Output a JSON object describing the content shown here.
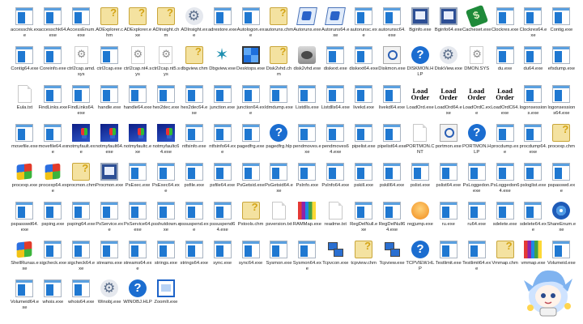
{
  "items": [
    {
      "label": "accesschk.exe",
      "icon": "exe"
    },
    {
      "label": "accesschk64.exe",
      "icon": "exe"
    },
    {
      "label": "AccessEnum.exe",
      "icon": "exe"
    },
    {
      "label": "ADExplorer.chm",
      "icon": "chm"
    },
    {
      "label": "ADExplorer.exe",
      "icon": "chm"
    },
    {
      "label": "ADInsight.chm",
      "icon": "chm"
    },
    {
      "label": "ADInsight.exe",
      "icon": "gear"
    },
    {
      "label": "adrestore.exe",
      "icon": "exe"
    },
    {
      "label": "Autologon.exe",
      "icon": "exe"
    },
    {
      "label": "autoruns.chm",
      "icon": "chm"
    },
    {
      "label": "Autoruns.exe",
      "icon": "autorun"
    },
    {
      "label": "Autoruns64.exe",
      "icon": "autorun"
    },
    {
      "label": "autorunsc.exe",
      "icon": "exe"
    },
    {
      "label": "autorunsc64.exe",
      "icon": "exe"
    },
    {
      "label": "Bginfo.exe",
      "icon": "mon"
    },
    {
      "label": "Bginfo64.exe",
      "icon": "mon"
    },
    {
      "label": "Cacheset.exe",
      "icon": "green"
    },
    {
      "label": "Clockres.exe",
      "icon": "exe"
    },
    {
      "label": "Clockres64.exe",
      "icon": "exe"
    },
    {
      "label": "Contig.exe",
      "icon": "exe"
    },
    {
      "label": "Contig64.exe",
      "icon": "exe"
    },
    {
      "label": "Coreinfo.exe",
      "icon": "exe"
    },
    {
      "label": "ctrl2cap.amd.sys",
      "icon": "sys"
    },
    {
      "label": "ctrl2cap.exe",
      "icon": "exe"
    },
    {
      "label": "ctrl2cap.nt4.sys",
      "icon": "sys"
    },
    {
      "label": "ctrl2cap.nt5.sys",
      "icon": "sys"
    },
    {
      "label": "dbgview.chm",
      "icon": "chm"
    },
    {
      "label": "Dbgview.exe",
      "icon": "bug"
    },
    {
      "label": "Desktops.exe",
      "icon": "grid4"
    },
    {
      "label": "Disk2vhd.chm",
      "icon": "chm"
    },
    {
      "label": "disk2vhd.exe",
      "icon": "disk"
    },
    {
      "label": "diskext.exe",
      "icon": "exe"
    },
    {
      "label": "diskext64.exe",
      "icon": "exe"
    },
    {
      "label": "Diskmon.exe",
      "icon": "mag"
    },
    {
      "label": "DISKMON.HLP",
      "icon": "hlp"
    },
    {
      "label": "DiskView.exe",
      "icon": "gear"
    },
    {
      "label": "DMON.SYS",
      "icon": "sys"
    },
    {
      "label": "du.exe",
      "icon": "exe"
    },
    {
      "label": "du64.exe",
      "icon": "exe"
    },
    {
      "label": "efsdump.exe",
      "icon": "exe"
    },
    {
      "label": "Eula.txt",
      "icon": "doc"
    },
    {
      "label": "FindLinks.exe",
      "icon": "exe"
    },
    {
      "label": "FindLinks64.exe",
      "icon": "exe"
    },
    {
      "label": "handle.exe",
      "icon": "exe"
    },
    {
      "label": "handle64.exe",
      "icon": "exe"
    },
    {
      "label": "hex2dec.exe",
      "icon": "exe"
    },
    {
      "label": "hex2dec64.exe",
      "icon": "exe"
    },
    {
      "label": "junction.exe",
      "icon": "exe"
    },
    {
      "label": "junction64.exe",
      "icon": "exe"
    },
    {
      "label": "ldmdump.exe",
      "icon": "exe"
    },
    {
      "label": "Listdlls.exe",
      "icon": "exe"
    },
    {
      "label": "Listdlls64.exe",
      "icon": "exe"
    },
    {
      "label": "livekd.exe",
      "icon": "exe"
    },
    {
      "label": "livekd64.exe",
      "icon": "exe"
    },
    {
      "label": "LoadOrd.exe",
      "icon": "load"
    },
    {
      "label": "LoadOrd64.exe",
      "icon": "load"
    },
    {
      "label": "LoadOrdC.exe",
      "icon": "load"
    },
    {
      "label": "LoadOrdC64.exe",
      "icon": "load"
    },
    {
      "label": "logonsessions.exe",
      "icon": "exe"
    },
    {
      "label": "logonsessions64.exe",
      "icon": "exe"
    },
    {
      "label": "movefile.exe",
      "icon": "exe"
    },
    {
      "label": "movefile64.exe",
      "icon": "exe"
    },
    {
      "label": "notmyfault.exe",
      "icon": "nt"
    },
    {
      "label": "notmyfault64.exe",
      "icon": "nt"
    },
    {
      "label": "notmyfaultc.exe",
      "icon": "nt"
    },
    {
      "label": "notmyfaultc64.exe",
      "icon": "nt"
    },
    {
      "label": "ntfsinfo.exe",
      "icon": "exe"
    },
    {
      "label": "ntfsinfo64.exe",
      "icon": "exe"
    },
    {
      "label": "pagedfrg.exe",
      "icon": "exe"
    },
    {
      "label": "pagedfrg.hlp",
      "icon": "hlp"
    },
    {
      "label": "pendmoves.exe",
      "icon": "exe"
    },
    {
      "label": "pendmoves64.exe",
      "icon": "exe"
    },
    {
      "label": "pipelist.exe",
      "icon": "exe"
    },
    {
      "label": "pipelist64.exe",
      "icon": "exe"
    },
    {
      "label": "PORTMON.CNT",
      "icon": "doc"
    },
    {
      "label": "portmon.exe",
      "icon": "mag"
    },
    {
      "label": "PORTMON.HLP",
      "icon": "hlp"
    },
    {
      "label": "procdump.exe",
      "icon": "exe"
    },
    {
      "label": "procdump64.exe",
      "icon": "exe"
    },
    {
      "label": "procexp.chm",
      "icon": "chm"
    },
    {
      "label": "procexp.exe",
      "icon": "flag"
    },
    {
      "label": "procexp64.exe",
      "icon": "flag"
    },
    {
      "label": "procmon.chm",
      "icon": "chm"
    },
    {
      "label": "Procmon.exe",
      "icon": "mon"
    },
    {
      "label": "PsExec.exe",
      "icon": "exe"
    },
    {
      "label": "PsExec64.exe",
      "icon": "exe"
    },
    {
      "label": "psfile.exe",
      "icon": "exe"
    },
    {
      "label": "psfile64.exe",
      "icon": "exe"
    },
    {
      "label": "PsGetsid.exe",
      "icon": "exe"
    },
    {
      "label": "PsGetsid64.exe",
      "icon": "exe"
    },
    {
      "label": "PsInfo.exe",
      "icon": "exe"
    },
    {
      "label": "PsInfo64.exe",
      "icon": "exe"
    },
    {
      "label": "pskill.exe",
      "icon": "exe"
    },
    {
      "label": "pskill64.exe",
      "icon": "exe"
    },
    {
      "label": "pslist.exe",
      "icon": "exe"
    },
    {
      "label": "pslist64.exe",
      "icon": "exe"
    },
    {
      "label": "PsLoggedon.exe",
      "icon": "exe"
    },
    {
      "label": "PsLoggedon64.exe",
      "icon": "exe"
    },
    {
      "label": "psloglist.exe",
      "icon": "exe"
    },
    {
      "label": "pspasswd.exe",
      "icon": "exe"
    },
    {
      "label": "pspasswd64.exe",
      "icon": "exe"
    },
    {
      "label": "psping.exe",
      "icon": "exe"
    },
    {
      "label": "psping64.exe",
      "icon": "exe"
    },
    {
      "label": "PsService.exe",
      "icon": "exe"
    },
    {
      "label": "PsService64.exe",
      "icon": "exe"
    },
    {
      "label": "psshutdown.exe",
      "icon": "exe"
    },
    {
      "label": "pssuspend.exe",
      "icon": "exe"
    },
    {
      "label": "pssuspend64.exe",
      "icon": "exe"
    },
    {
      "label": "Pstools.chm",
      "icon": "chm"
    },
    {
      "label": "psversion.txt",
      "icon": "doc"
    },
    {
      "label": "RAMMap.exe",
      "icon": "bars"
    },
    {
      "label": "readme.txt",
      "icon": "doc"
    },
    {
      "label": "RegDelNull.exe",
      "icon": "exe"
    },
    {
      "label": "RegDelNull64.exe",
      "icon": "exe"
    },
    {
      "label": "regjump.exe",
      "icon": "orange"
    },
    {
      "label": "ru.exe",
      "icon": "exe"
    },
    {
      "label": "ru64.exe",
      "icon": "exe"
    },
    {
      "label": "sdelete.exe",
      "icon": "exe"
    },
    {
      "label": "sdelete64.exe",
      "icon": "exe"
    },
    {
      "label": "ShareEnum.exe",
      "icon": "share"
    },
    {
      "label": "ShellRunas.exe",
      "icon": "flag"
    },
    {
      "label": "sigcheck.exe",
      "icon": "exe"
    },
    {
      "label": "sigcheck64.exe",
      "icon": "exe"
    },
    {
      "label": "streams.exe",
      "icon": "exe"
    },
    {
      "label": "streams64.exe",
      "icon": "exe"
    },
    {
      "label": "strings.exe",
      "icon": "exe"
    },
    {
      "label": "strings64.exe",
      "icon": "exe"
    },
    {
      "label": "sync.exe",
      "icon": "exe"
    },
    {
      "label": "sync64.exe",
      "icon": "exe"
    },
    {
      "label": "Sysmon.exe",
      "icon": "exe"
    },
    {
      "label": "Sysmon64.exe",
      "icon": "exe"
    },
    {
      "label": "Tcpvcon.exe",
      "icon": "net"
    },
    {
      "label": "tcpview.chm",
      "icon": "chm"
    },
    {
      "label": "Tcpview.exe",
      "icon": "net"
    },
    {
      "label": "TCPVIEW.HLP",
      "icon": "hlp"
    },
    {
      "label": "Testlimit.exe",
      "icon": "exe"
    },
    {
      "label": "Testlimit64.exe",
      "icon": "exe"
    },
    {
      "label": "Vmmap.chm",
      "icon": "chm"
    },
    {
      "label": "vmmap.exe",
      "icon": "bars"
    },
    {
      "label": "Volumeid.exe",
      "icon": "exe"
    },
    {
      "label": "Volumeid64.exe",
      "icon": "exe"
    },
    {
      "label": "whois.exe",
      "icon": "exe"
    },
    {
      "label": "whois64.exe",
      "icon": "exe"
    },
    {
      "label": "Winobj.exe",
      "icon": "gear"
    },
    {
      "label": "WINOBJ.HLP",
      "icon": "hlp"
    },
    {
      "label": "ZoomIt.exe",
      "icon": "zoom"
    }
  ]
}
